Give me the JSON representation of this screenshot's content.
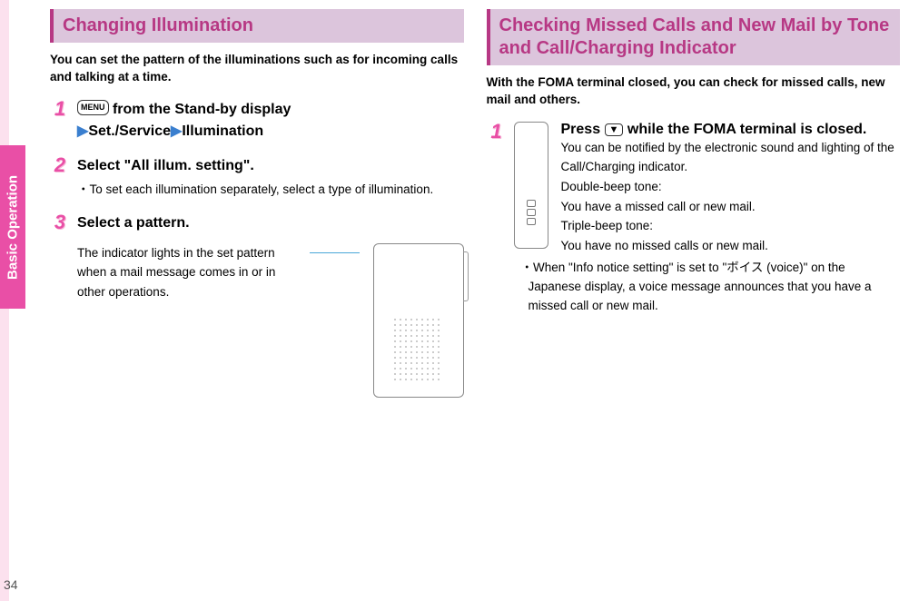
{
  "side_tab": "Basic Operation",
  "page_number": "34",
  "left": {
    "title": "Changing Illumination",
    "intro": "You can set the pattern of the illuminations such as for incoming calls and talking at a time.",
    "steps": {
      "s1": {
        "num": "1",
        "menu_key": "MENU",
        "after_key": " from the Stand-by display",
        "line2a": "Set./Service",
        "line2b": "Illumination"
      },
      "s2": {
        "num": "2",
        "head": "Select \"All illum. setting\".",
        "bullet": "To set each illumination separately, select a type of illumination."
      },
      "s3": {
        "num": "3",
        "head": "Select a pattern.",
        "indicator": "The indicator lights in the set pattern when a mail message comes in or in other operations."
      }
    }
  },
  "right": {
    "title": "Checking Missed Calls and New Mail by Tone and Call/Charging Indicator",
    "intro": "With the FOMA terminal closed, you can check for missed calls, new mail and others.",
    "step1": {
      "num": "1",
      "head_pre": "Press ",
      "key": "▼",
      "head_post": " while the FOMA terminal is closed.",
      "body1": "You can be notified by the electronic sound and lighting of the Call/Charging indicator.",
      "body2": "Double-beep tone:",
      "body3": "You have a missed call or new mail.",
      "body4": "Triple-beep tone:",
      "body5": "You have no missed calls or new mail.",
      "bullet": "When \"Info notice setting\" is set to \"ボイス (voice)\" on the Japanese display, a voice message announces that you have a missed call or new mail."
    }
  }
}
